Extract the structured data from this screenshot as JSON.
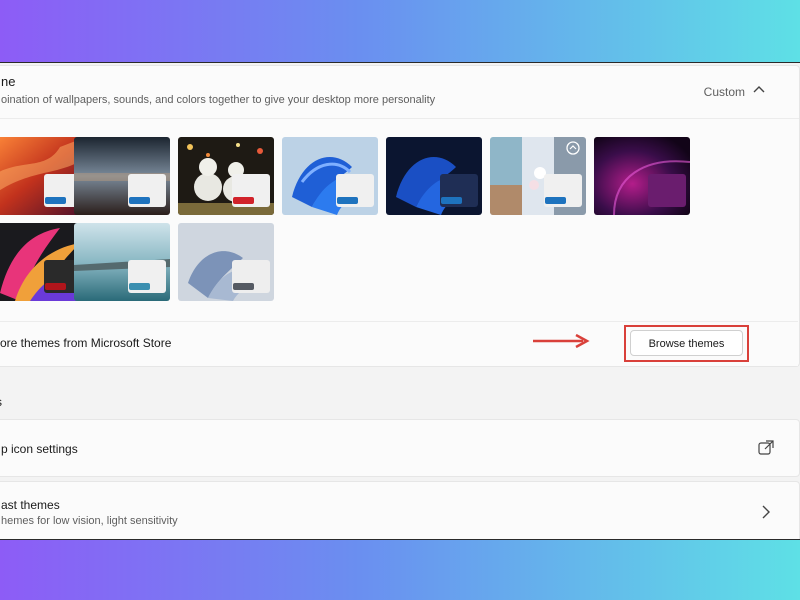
{
  "theme": {
    "title": "ne",
    "subtitle": "oination of wallpapers, sounds, and colors together to give your desktop more personality",
    "state": "Custom",
    "tiles": [
      {
        "name": "glow-orange",
        "preview": "#f0f0f0",
        "accent": "#1e73be"
      },
      {
        "name": "dark-lake",
        "preview": "#f0f0f0",
        "accent": "#1e73be"
      },
      {
        "name": "snowmen",
        "preview": "#f0f0f0",
        "accent": "#d1222a"
      },
      {
        "name": "windows-bloom-light",
        "preview": "#f0f0f0",
        "accent": "#1e73be"
      },
      {
        "name": "windows-bloom-dark",
        "preview": "#1f2e55",
        "accent": "#1e73be"
      },
      {
        "name": "spotlight",
        "preview": "#f0f0f0",
        "accent": "#1e73be"
      },
      {
        "name": "purple-glow",
        "preview": "#6a1d6e",
        "accent": "#6a1d6e"
      },
      {
        "name": "captured-motion",
        "preview": "#2a2a2a",
        "accent": "#b0151b"
      },
      {
        "name": "flow",
        "preview": "#f0f0f0",
        "accent": "#3b8fb0"
      },
      {
        "name": "sunrise",
        "preview": "#eeeeee",
        "accent": "#555a63"
      }
    ]
  },
  "store": {
    "text": "ore themes from Microsoft Store",
    "button": "Browse themes",
    "highlight_color": "#d9403a"
  },
  "section": {
    "label": "s"
  },
  "rows": {
    "desktop_icons": {
      "title": "p icon settings",
      "icon": "external-link-icon"
    },
    "contrast": {
      "title": "ast themes",
      "subtitle": "hemes for low vision, light sensitivity",
      "icon": "chevron-right-icon"
    }
  }
}
